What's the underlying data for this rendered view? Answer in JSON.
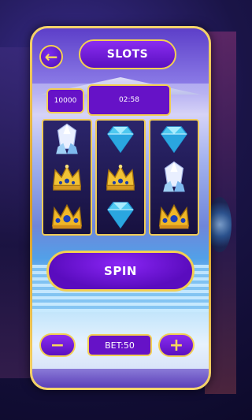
{
  "header": {
    "back_icon": "arrow-left-icon",
    "title": "SLOTS"
  },
  "stats": {
    "coins": "10000",
    "timer": "02:58"
  },
  "reels": [
    [
      "crystal",
      "gold-crown",
      "blue-crown"
    ],
    [
      "diamond",
      "gold-crown",
      "diamond"
    ],
    [
      "diamond",
      "crystal",
      "blue-crown"
    ]
  ],
  "controls": {
    "spin_label": "SPIN",
    "minus_label": "−",
    "plus_label": "+",
    "bet_label": "BET:50"
  },
  "colors": {
    "accent": "#f3cf52",
    "button": "#6612c7",
    "background": "#1a1447"
  }
}
